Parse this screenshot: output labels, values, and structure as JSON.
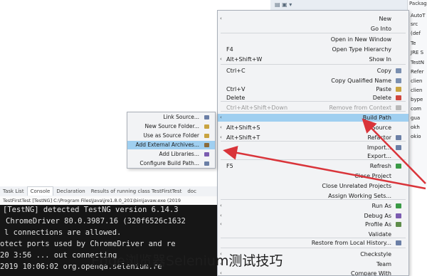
{
  "package_explorer": {
    "title": "Package Explorer",
    "rows": [
      "AutoT",
      "src",
      "(def",
      "Te",
      "JRE S",
      "TestN",
      "Refer",
      "clien",
      "clien",
      "bype",
      "com",
      "gua",
      "okh",
      "okio"
    ]
  },
  "context_menu": {
    "items": [
      {
        "label": "New",
        "shortcut": "",
        "arrow": true,
        "disabled": false,
        "selected": false
      },
      {
        "label": "Go Into",
        "shortcut": "",
        "arrow": false,
        "disabled": false,
        "selected": false
      },
      {
        "label": "Open in New Window",
        "shortcut": "",
        "arrow": false,
        "disabled": false,
        "selected": false
      },
      {
        "label": "Open Type Hierarchy",
        "shortcut": "F4",
        "arrow": false,
        "disabled": false,
        "selected": false
      },
      {
        "label": "Show In",
        "shortcut": "Alt+Shift+W",
        "arrow": true,
        "disabled": false,
        "selected": false
      },
      {
        "label": "Copy",
        "shortcut": "Ctrl+C",
        "arrow": false,
        "disabled": false,
        "selected": false
      },
      {
        "label": "Copy Qualified Name",
        "shortcut": "",
        "arrow": false,
        "disabled": false,
        "selected": false
      },
      {
        "label": "Paste",
        "shortcut": "Ctrl+V",
        "arrow": false,
        "disabled": false,
        "selected": false
      },
      {
        "label": "Delete",
        "shortcut": "Delete",
        "arrow": false,
        "disabled": false,
        "selected": false
      },
      {
        "label": "Remove from Context",
        "shortcut": "Ctrl+Alt+Shift+Down",
        "arrow": false,
        "disabled": true,
        "selected": false
      },
      {
        "label": "Build Path",
        "shortcut": "",
        "arrow": true,
        "disabled": false,
        "selected": true
      },
      {
        "label": "Source",
        "shortcut": "Alt+Shift+S",
        "arrow": true,
        "disabled": false,
        "selected": false
      },
      {
        "label": "Refactor",
        "shortcut": "Alt+Shift+T",
        "arrow": true,
        "disabled": false,
        "selected": false
      },
      {
        "label": "Import...",
        "shortcut": "",
        "arrow": false,
        "disabled": false,
        "selected": false
      },
      {
        "label": "Export...",
        "shortcut": "",
        "arrow": false,
        "disabled": false,
        "selected": false
      },
      {
        "label": "Refresh",
        "shortcut": "F5",
        "arrow": false,
        "disabled": false,
        "selected": false
      },
      {
        "label": "Close Project",
        "shortcut": "",
        "arrow": false,
        "disabled": false,
        "selected": false
      },
      {
        "label": "Close Unrelated Projects",
        "shortcut": "",
        "arrow": false,
        "disabled": false,
        "selected": false
      },
      {
        "label": "Assign Working Sets...",
        "shortcut": "",
        "arrow": false,
        "disabled": false,
        "selected": false
      },
      {
        "label": "Run As",
        "shortcut": "",
        "arrow": true,
        "disabled": false,
        "selected": false
      },
      {
        "label": "Debug As",
        "shortcut": "",
        "arrow": true,
        "disabled": false,
        "selected": false
      },
      {
        "label": "Profile As",
        "shortcut": "",
        "arrow": true,
        "disabled": false,
        "selected": false
      },
      {
        "label": "Validate",
        "shortcut": "",
        "arrow": false,
        "disabled": false,
        "selected": false
      },
      {
        "label": "Restore from Local History...",
        "shortcut": "",
        "arrow": false,
        "disabled": false,
        "selected": false
      },
      {
        "label": "Checkstyle",
        "shortcut": "",
        "arrow": true,
        "disabled": false,
        "selected": false
      },
      {
        "label": "Team",
        "shortcut": "",
        "arrow": true,
        "disabled": false,
        "selected": false
      },
      {
        "label": "Compare With",
        "shortcut": "",
        "arrow": true,
        "disabled": false,
        "selected": false
      }
    ]
  },
  "build_path_submenu": {
    "items": [
      {
        "label": "Link Source...",
        "selected": false
      },
      {
        "label": "New Source Folder...",
        "selected": false
      },
      {
        "label": "Use as Source Folder",
        "selected": false
      },
      {
        "label": "Add External Archives...",
        "selected": true
      },
      {
        "label": "Add Libraries...",
        "selected": false
      },
      {
        "label": "Configure Build Path...",
        "selected": false
      }
    ]
  },
  "console": {
    "tabs": [
      "Task List",
      "Console",
      "Declaration",
      "Results of running class TestFirstTest",
      "doc"
    ],
    "active_tab": "Console",
    "header": "TestFirstTest [TestNG] C:\\Program Files\\Java\\jre1.8.0_201\\bin\\javaw.exe (2019",
    "lines": [
      "[TestNG] detected TestNG version 6.14.3",
      "ChromeDriver 80.0.3987.16 (320f6526c1632",
      "l connections are allowed.",
      "otect ports used by ChromeDriver and re",
      "20 3:56 ... out connecting",
      "2019 10:06:02 org.openqa.selenium.re"
    ]
  },
  "caption": "Edge浏览器Selenium测试技巧",
  "colors": {
    "selection": "#9fcff0",
    "arrow_red": "#d9343a",
    "console_bg": "#161616"
  }
}
